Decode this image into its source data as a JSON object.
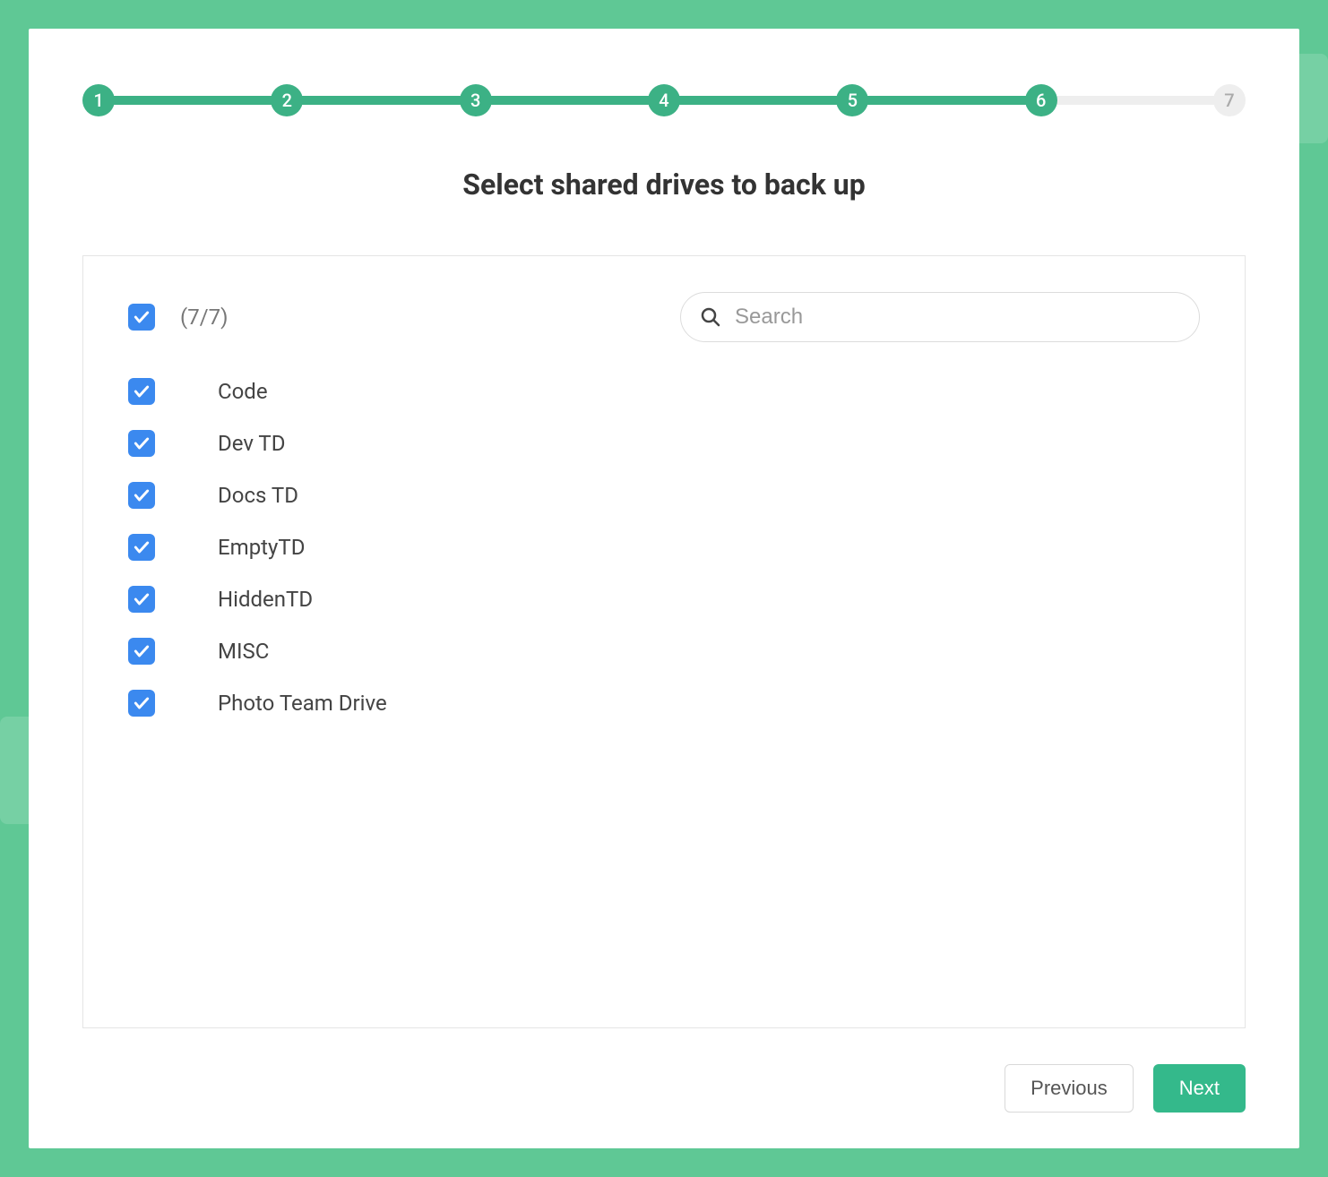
{
  "colors": {
    "accent": "#3cb185",
    "checkbox": "#3b89ef",
    "background": "#5fc895"
  },
  "stepper": {
    "steps": [
      "1",
      "2",
      "3",
      "4",
      "5",
      "6",
      "7"
    ],
    "current_index": 5
  },
  "title": "Select shared drives to back up",
  "select_all": {
    "checked": true,
    "count_label": "(7/7)"
  },
  "search": {
    "placeholder": "Search",
    "value": ""
  },
  "drives": [
    {
      "label": "Code",
      "checked": true
    },
    {
      "label": "Dev TD",
      "checked": true
    },
    {
      "label": "Docs TD",
      "checked": true
    },
    {
      "label": "EmptyTD",
      "checked": true
    },
    {
      "label": "HiddenTD",
      "checked": true
    },
    {
      "label": "MISC",
      "checked": true
    },
    {
      "label": "Photo Team Drive",
      "checked": true
    }
  ],
  "footer": {
    "previous_label": "Previous",
    "next_label": "Next"
  }
}
